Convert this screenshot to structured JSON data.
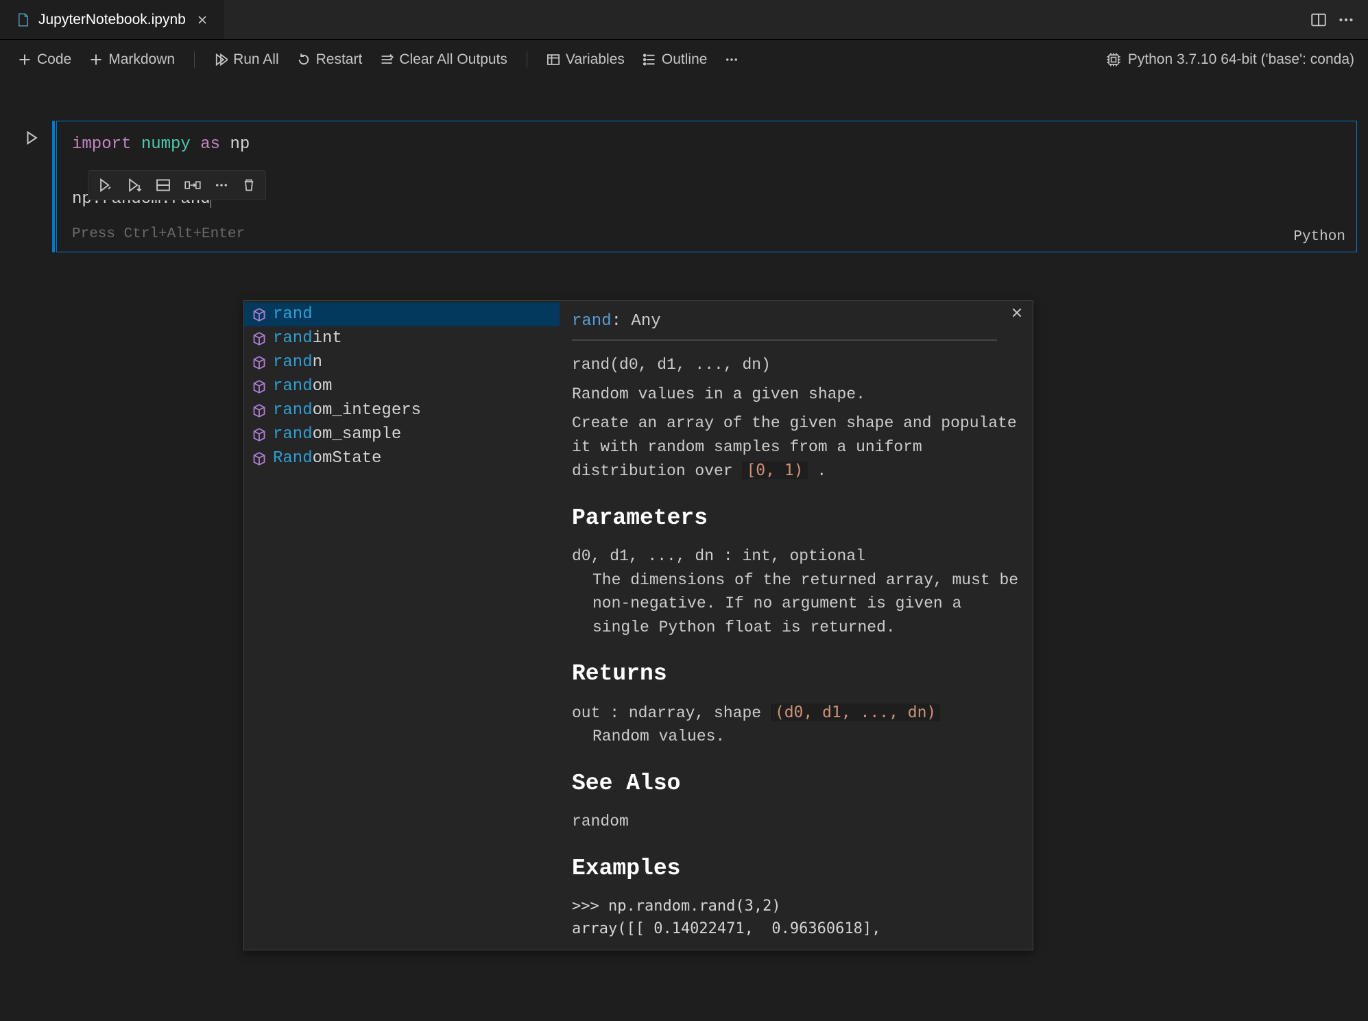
{
  "tab": {
    "filename": "JupyterNotebook.ipynb"
  },
  "toolbar": {
    "code": "Code",
    "markdown": "Markdown",
    "run_all": "Run All",
    "restart": "Restart",
    "clear_outputs": "Clear All Outputs",
    "variables": "Variables",
    "outline": "Outline"
  },
  "kernel": {
    "label": "Python 3.7.10 64-bit ('base': conda)"
  },
  "cell": {
    "code_line1_import": "import",
    "code_line1_pkg": " numpy ",
    "code_line1_as": "as",
    "code_line1_alias": " np",
    "code_line3": "np.random.rand",
    "hint": "Press Ctrl+Alt+Enter",
    "lang": "Python"
  },
  "suggest": {
    "items": [
      {
        "match": "rand",
        "rest": ""
      },
      {
        "match": "rand",
        "rest": "int"
      },
      {
        "match": "rand",
        "rest": "n"
      },
      {
        "match": "rand",
        "rest": "om"
      },
      {
        "match": "rand",
        "rest": "om_integers"
      },
      {
        "match": "rand",
        "rest": "om_sample"
      },
      {
        "match": "Rand",
        "rest": "omState"
      }
    ],
    "detail": {
      "sig_name": "rand",
      "sig_sep": ": ",
      "sig_type": "Any",
      "call": "rand(d0, d1, ..., dn)",
      "summary": "Random values in a given shape.",
      "desc_pre": "Create an array of the given shape and populate it with random samples from a uniform distribution over ",
      "desc_code": "[0, 1)",
      "desc_post": " .",
      "h_params": "Parameters",
      "params_line1": "d0, d1, ..., dn : int, optional",
      "params_line2": "The dimensions of the returned array, must be non-negative. If no argument is given a single Python float is returned.",
      "h_returns": "Returns",
      "returns_pre": "out : ndarray, shape ",
      "returns_code": "(d0, d1, ..., dn)",
      "returns_line2": "Random values.",
      "h_seealso": "See Also",
      "seealso": "random",
      "h_examples": "Examples",
      "example_l1": ">>> np.random.rand(3,2)",
      "example_l2": "array([[ 0.14022471,  0.96360618],"
    }
  }
}
